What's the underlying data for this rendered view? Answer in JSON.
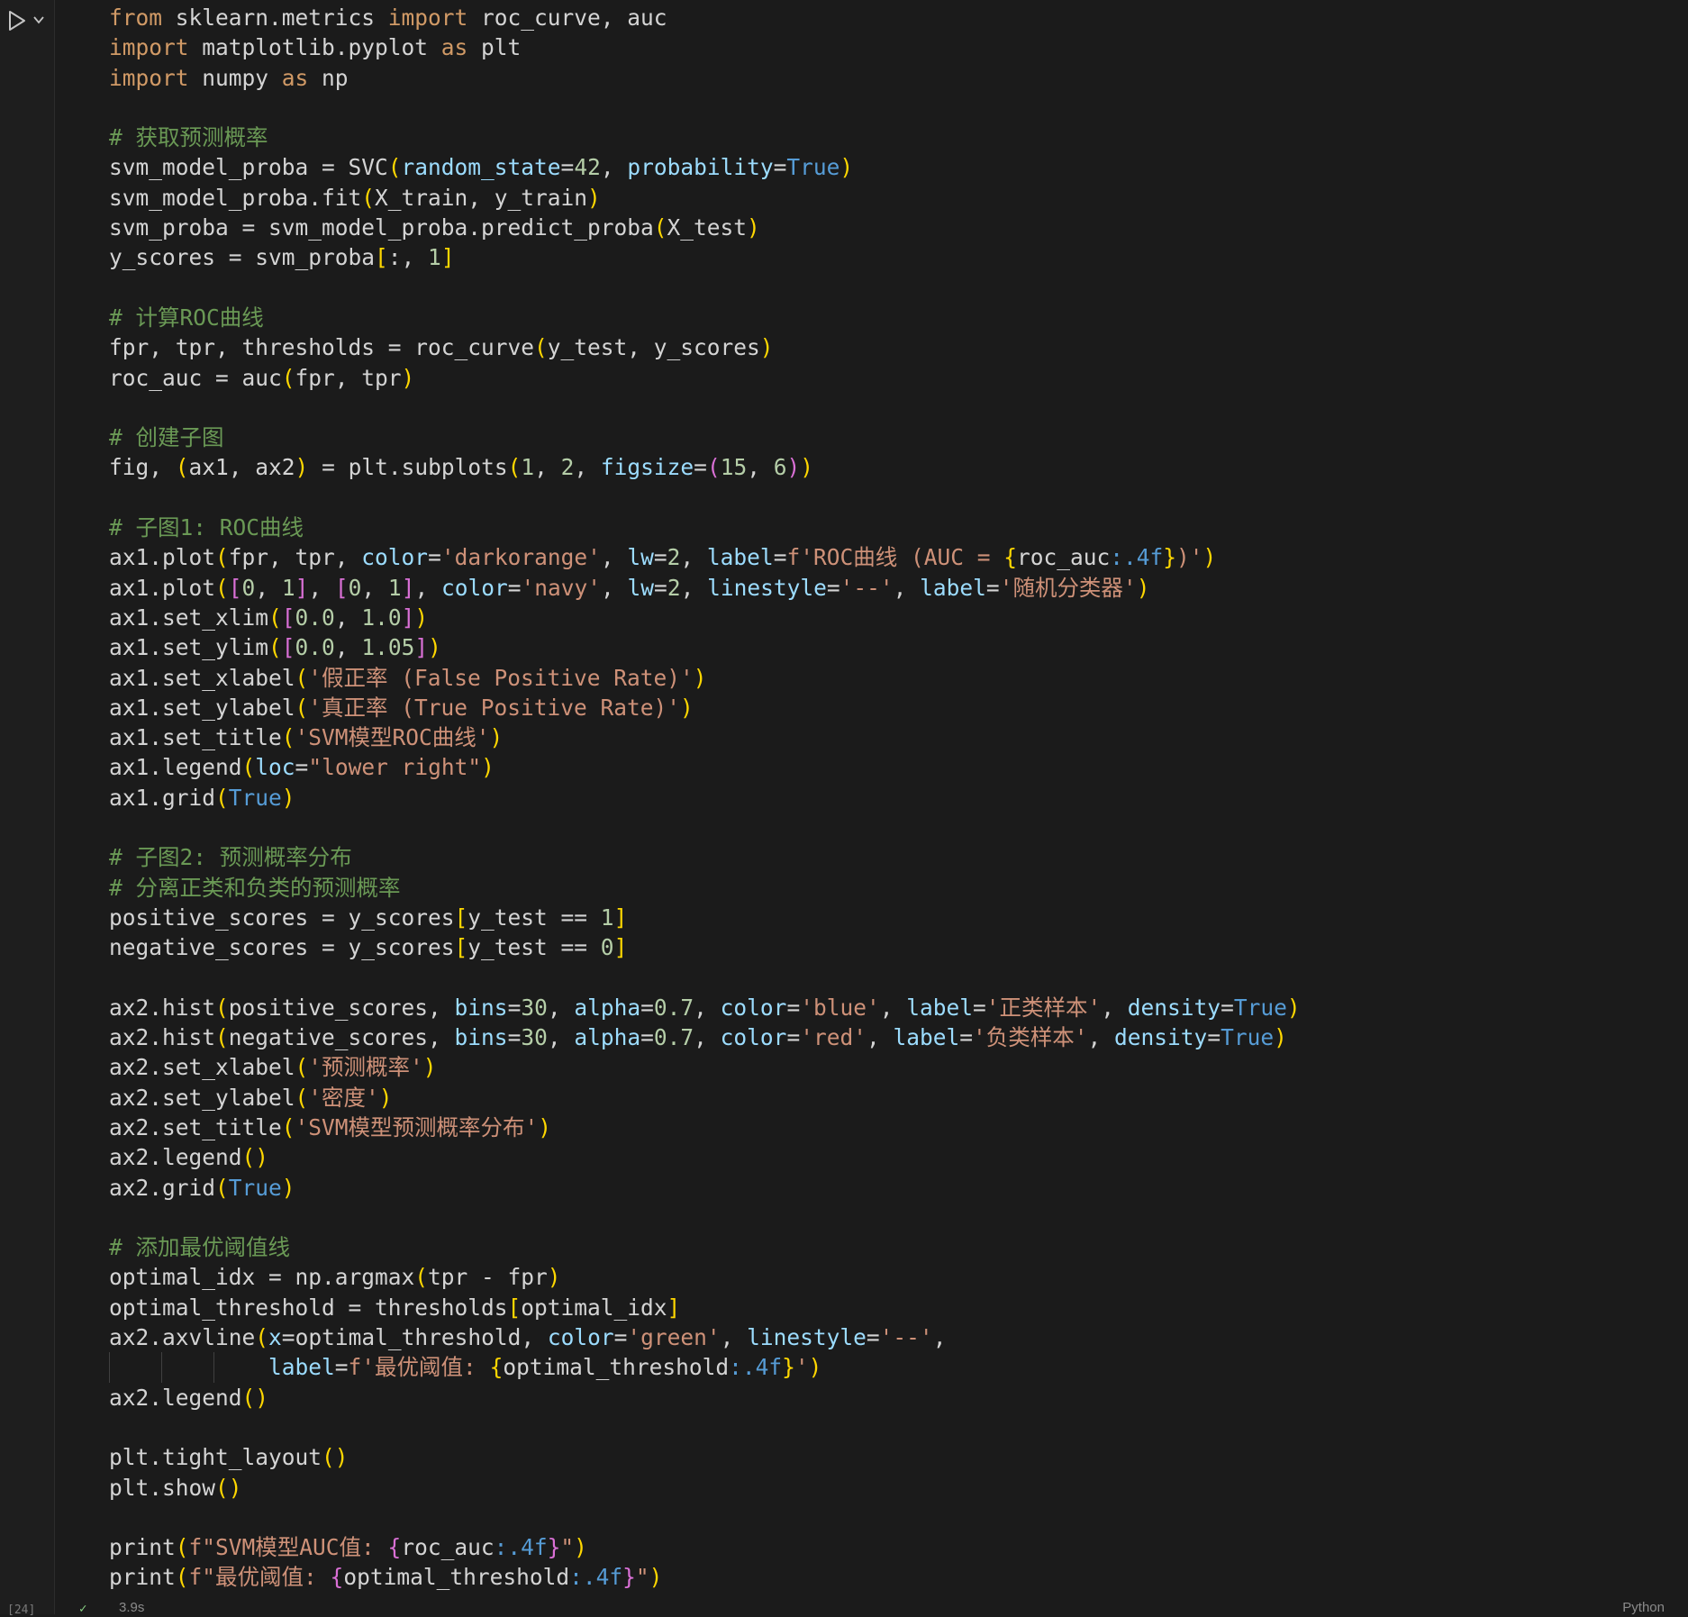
{
  "cell": {
    "execution_count": "[24]",
    "duration": "3.9s",
    "language": "Python",
    "status_icon": "check-icon"
  },
  "colors": {
    "default": "#d4d4d4",
    "keyword": "#ce9178",
    "import_keyword": "#d19a66",
    "string": "#ce9178",
    "number": "#b5cea8",
    "comment": "#6a9955",
    "param": "#9cdcfe",
    "constant": "#569cd6",
    "bracket_yellow": "#ffd700",
    "bracket_purple": "#da70d6",
    "bracket_blue": "#179fff"
  },
  "code_lines": [
    {
      "guides": 0,
      "tokens": [
        [
          "from ",
          "k"
        ],
        [
          "sklearn.metrics ",
          "d"
        ],
        [
          "import ",
          "k"
        ],
        [
          "roc_curve, auc",
          "d"
        ]
      ]
    },
    {
      "guides": 0,
      "tokens": [
        [
          "import ",
          "k"
        ],
        [
          "matplotlib.pyplot ",
          "d"
        ],
        [
          "as ",
          "k"
        ],
        [
          "plt",
          "d"
        ]
      ]
    },
    {
      "guides": 0,
      "tokens": [
        [
          "import ",
          "k"
        ],
        [
          "numpy ",
          "d"
        ],
        [
          "as ",
          "k"
        ],
        [
          "np",
          "d"
        ]
      ]
    },
    {
      "guides": 0,
      "tokens": []
    },
    {
      "guides": 0,
      "tokens": [
        [
          "# 获取预测概率",
          "c"
        ]
      ]
    },
    {
      "guides": 0,
      "tokens": [
        [
          "svm_model_proba = SVC",
          "d"
        ],
        [
          "(",
          "y"
        ],
        [
          "random_state",
          "p"
        ],
        [
          "=",
          "d"
        ],
        [
          "42",
          "n"
        ],
        [
          ", ",
          "d"
        ],
        [
          "probability",
          "p"
        ],
        [
          "=",
          "d"
        ],
        [
          "True",
          "b"
        ],
        [
          ")",
          "y"
        ]
      ]
    },
    {
      "guides": 0,
      "tokens": [
        [
          "svm_model_proba.fit",
          "d"
        ],
        [
          "(",
          "y"
        ],
        [
          "X_train, y_train",
          "d"
        ],
        [
          ")",
          "y"
        ]
      ]
    },
    {
      "guides": 0,
      "tokens": [
        [
          "svm_proba = svm_model_proba.predict_proba",
          "d"
        ],
        [
          "(",
          "y"
        ],
        [
          "X_test",
          "d"
        ],
        [
          ")",
          "y"
        ]
      ]
    },
    {
      "guides": 0,
      "tokens": [
        [
          "y_scores = svm_proba",
          "d"
        ],
        [
          "[",
          "y"
        ],
        [
          ":, ",
          "d"
        ],
        [
          "1",
          "n"
        ],
        [
          "]",
          "y"
        ]
      ]
    },
    {
      "guides": 0,
      "tokens": []
    },
    {
      "guides": 0,
      "tokens": [
        [
          "# 计算ROC曲线",
          "c"
        ]
      ]
    },
    {
      "guides": 0,
      "tokens": [
        [
          "fpr, tpr, thresholds = roc_curve",
          "d"
        ],
        [
          "(",
          "y"
        ],
        [
          "y_test, y_scores",
          "d"
        ],
        [
          ")",
          "y"
        ]
      ]
    },
    {
      "guides": 0,
      "tokens": [
        [
          "roc_auc = auc",
          "d"
        ],
        [
          "(",
          "y"
        ],
        [
          "fpr, tpr",
          "d"
        ],
        [
          ")",
          "y"
        ]
      ]
    },
    {
      "guides": 0,
      "tokens": []
    },
    {
      "guides": 0,
      "tokens": [
        [
          "# 创建子图",
          "c"
        ]
      ]
    },
    {
      "guides": 0,
      "tokens": [
        [
          "fig, ",
          "d"
        ],
        [
          "(",
          "y"
        ],
        [
          "ax1, ax2",
          "d"
        ],
        [
          ")",
          "y"
        ],
        [
          " = plt.subplots",
          "d"
        ],
        [
          "(",
          "y"
        ],
        [
          "1",
          "n"
        ],
        [
          ", ",
          "d"
        ],
        [
          "2",
          "n"
        ],
        [
          ", ",
          "d"
        ],
        [
          "figsize",
          "p"
        ],
        [
          "=",
          "d"
        ],
        [
          "(",
          "v"
        ],
        [
          "15",
          "n"
        ],
        [
          ", ",
          "d"
        ],
        [
          "6",
          "n"
        ],
        [
          ")",
          "v"
        ],
        [
          ")",
          "y"
        ]
      ]
    },
    {
      "guides": 0,
      "tokens": []
    },
    {
      "guides": 0,
      "tokens": [
        [
          "# 子图1: ROC曲线",
          "c"
        ]
      ]
    },
    {
      "guides": 0,
      "tokens": [
        [
          "ax1.plot",
          "d"
        ],
        [
          "(",
          "y"
        ],
        [
          "fpr, tpr, ",
          "d"
        ],
        [
          "color",
          "p"
        ],
        [
          "=",
          "d"
        ],
        [
          "'darkorange'",
          "s"
        ],
        [
          ", ",
          "d"
        ],
        [
          "lw",
          "p"
        ],
        [
          "=",
          "d"
        ],
        [
          "2",
          "n"
        ],
        [
          ", ",
          "d"
        ],
        [
          "label",
          "p"
        ],
        [
          "=",
          "d"
        ],
        [
          "f'ROC曲线 (AUC = ",
          "s"
        ],
        [
          "{",
          "y"
        ],
        [
          "roc_auc",
          "d"
        ],
        [
          ":.4f",
          "b"
        ],
        [
          "}",
          "y"
        ],
        [
          ")'",
          "s"
        ],
        [
          ")",
          "y"
        ]
      ]
    },
    {
      "guides": 0,
      "tokens": [
        [
          "ax1.plot",
          "d"
        ],
        [
          "(",
          "y"
        ],
        [
          "[",
          "v"
        ],
        [
          "0",
          "n"
        ],
        [
          ", ",
          "d"
        ],
        [
          "1",
          "n"
        ],
        [
          "]",
          "v"
        ],
        [
          ", ",
          "d"
        ],
        [
          "[",
          "v"
        ],
        [
          "0",
          "n"
        ],
        [
          ", ",
          "d"
        ],
        [
          "1",
          "n"
        ],
        [
          "]",
          "v"
        ],
        [
          ", ",
          "d"
        ],
        [
          "color",
          "p"
        ],
        [
          "=",
          "d"
        ],
        [
          "'navy'",
          "s"
        ],
        [
          ", ",
          "d"
        ],
        [
          "lw",
          "p"
        ],
        [
          "=",
          "d"
        ],
        [
          "2",
          "n"
        ],
        [
          ", ",
          "d"
        ],
        [
          "linestyle",
          "p"
        ],
        [
          "=",
          "d"
        ],
        [
          "'--'",
          "s"
        ],
        [
          ", ",
          "d"
        ],
        [
          "label",
          "p"
        ],
        [
          "=",
          "d"
        ],
        [
          "'随机分类器'",
          "s"
        ],
        [
          ")",
          "y"
        ]
      ]
    },
    {
      "guides": 0,
      "tokens": [
        [
          "ax1.set_xlim",
          "d"
        ],
        [
          "(",
          "y"
        ],
        [
          "[",
          "v"
        ],
        [
          "0.0",
          "n"
        ],
        [
          ", ",
          "d"
        ],
        [
          "1.0",
          "n"
        ],
        [
          "]",
          "v"
        ],
        [
          ")",
          "y"
        ]
      ]
    },
    {
      "guides": 0,
      "tokens": [
        [
          "ax1.set_ylim",
          "d"
        ],
        [
          "(",
          "y"
        ],
        [
          "[",
          "v"
        ],
        [
          "0.0",
          "n"
        ],
        [
          ", ",
          "d"
        ],
        [
          "1.05",
          "n"
        ],
        [
          "]",
          "v"
        ],
        [
          ")",
          "y"
        ]
      ]
    },
    {
      "guides": 0,
      "tokens": [
        [
          "ax1.set_xlabel",
          "d"
        ],
        [
          "(",
          "y"
        ],
        [
          "'假正率 (False Positive Rate)'",
          "s"
        ],
        [
          ")",
          "y"
        ]
      ]
    },
    {
      "guides": 0,
      "tokens": [
        [
          "ax1.set_ylabel",
          "d"
        ],
        [
          "(",
          "y"
        ],
        [
          "'真正率 (True Positive Rate)'",
          "s"
        ],
        [
          ")",
          "y"
        ]
      ]
    },
    {
      "guides": 0,
      "tokens": [
        [
          "ax1.set_title",
          "d"
        ],
        [
          "(",
          "y"
        ],
        [
          "'SVM模型ROC曲线'",
          "s"
        ],
        [
          ")",
          "y"
        ]
      ]
    },
    {
      "guides": 0,
      "tokens": [
        [
          "ax1.legend",
          "d"
        ],
        [
          "(",
          "y"
        ],
        [
          "loc",
          "p"
        ],
        [
          "=",
          "d"
        ],
        [
          "\"lower right\"",
          "s"
        ],
        [
          ")",
          "y"
        ]
      ]
    },
    {
      "guides": 0,
      "tokens": [
        [
          "ax1.grid",
          "d"
        ],
        [
          "(",
          "y"
        ],
        [
          "True",
          "b"
        ],
        [
          ")",
          "y"
        ]
      ]
    },
    {
      "guides": 0,
      "tokens": []
    },
    {
      "guides": 0,
      "tokens": [
        [
          "# 子图2: 预测概率分布",
          "c"
        ]
      ]
    },
    {
      "guides": 0,
      "tokens": [
        [
          "# 分离正类和负类的预测概率",
          "c"
        ]
      ]
    },
    {
      "guides": 0,
      "tokens": [
        [
          "positive_scores = y_scores",
          "d"
        ],
        [
          "[",
          "y"
        ],
        [
          "y_test == ",
          "d"
        ],
        [
          "1",
          "n"
        ],
        [
          "]",
          "y"
        ]
      ]
    },
    {
      "guides": 0,
      "tokens": [
        [
          "negative_scores = y_scores",
          "d"
        ],
        [
          "[",
          "y"
        ],
        [
          "y_test == ",
          "d"
        ],
        [
          "0",
          "n"
        ],
        [
          "]",
          "y"
        ]
      ]
    },
    {
      "guides": 0,
      "tokens": []
    },
    {
      "guides": 0,
      "tokens": [
        [
          "ax2.hist",
          "d"
        ],
        [
          "(",
          "y"
        ],
        [
          "positive_scores, ",
          "d"
        ],
        [
          "bins",
          "p"
        ],
        [
          "=",
          "d"
        ],
        [
          "30",
          "n"
        ],
        [
          ", ",
          "d"
        ],
        [
          "alpha",
          "p"
        ],
        [
          "=",
          "d"
        ],
        [
          "0.7",
          "n"
        ],
        [
          ", ",
          "d"
        ],
        [
          "color",
          "p"
        ],
        [
          "=",
          "d"
        ],
        [
          "'blue'",
          "s"
        ],
        [
          ", ",
          "d"
        ],
        [
          "label",
          "p"
        ],
        [
          "=",
          "d"
        ],
        [
          "'正类样本'",
          "s"
        ],
        [
          ", ",
          "d"
        ],
        [
          "density",
          "p"
        ],
        [
          "=",
          "d"
        ],
        [
          "True",
          "b"
        ],
        [
          ")",
          "y"
        ]
      ]
    },
    {
      "guides": 0,
      "tokens": [
        [
          "ax2.hist",
          "d"
        ],
        [
          "(",
          "y"
        ],
        [
          "negative_scores, ",
          "d"
        ],
        [
          "bins",
          "p"
        ],
        [
          "=",
          "d"
        ],
        [
          "30",
          "n"
        ],
        [
          ", ",
          "d"
        ],
        [
          "alpha",
          "p"
        ],
        [
          "=",
          "d"
        ],
        [
          "0.7",
          "n"
        ],
        [
          ", ",
          "d"
        ],
        [
          "color",
          "p"
        ],
        [
          "=",
          "d"
        ],
        [
          "'red'",
          "s"
        ],
        [
          ", ",
          "d"
        ],
        [
          "label",
          "p"
        ],
        [
          "=",
          "d"
        ],
        [
          "'负类样本'",
          "s"
        ],
        [
          ", ",
          "d"
        ],
        [
          "density",
          "p"
        ],
        [
          "=",
          "d"
        ],
        [
          "True",
          "b"
        ],
        [
          ")",
          "y"
        ]
      ]
    },
    {
      "guides": 0,
      "tokens": [
        [
          "ax2.set_xlabel",
          "d"
        ],
        [
          "(",
          "y"
        ],
        [
          "'预测概率'",
          "s"
        ],
        [
          ")",
          "y"
        ]
      ]
    },
    {
      "guides": 0,
      "tokens": [
        [
          "ax2.set_ylabel",
          "d"
        ],
        [
          "(",
          "y"
        ],
        [
          "'密度'",
          "s"
        ],
        [
          ")",
          "y"
        ]
      ]
    },
    {
      "guides": 0,
      "tokens": [
        [
          "ax2.set_title",
          "d"
        ],
        [
          "(",
          "y"
        ],
        [
          "'SVM模型预测概率分布'",
          "s"
        ],
        [
          ")",
          "y"
        ]
      ]
    },
    {
      "guides": 0,
      "tokens": [
        [
          "ax2.legend",
          "d"
        ],
        [
          "()",
          "y"
        ]
      ]
    },
    {
      "guides": 0,
      "tokens": [
        [
          "ax2.grid",
          "d"
        ],
        [
          "(",
          "y"
        ],
        [
          "True",
          "b"
        ],
        [
          ")",
          "y"
        ]
      ]
    },
    {
      "guides": 0,
      "tokens": []
    },
    {
      "guides": 0,
      "tokens": [
        [
          "# 添加最优阈值线",
          "c"
        ]
      ]
    },
    {
      "guides": 0,
      "tokens": [
        [
          "optimal_idx = np.argmax",
          "d"
        ],
        [
          "(",
          "y"
        ],
        [
          "tpr - fpr",
          "d"
        ],
        [
          ")",
          "y"
        ]
      ]
    },
    {
      "guides": 0,
      "tokens": [
        [
          "optimal_threshold = thresholds",
          "d"
        ],
        [
          "[",
          "y"
        ],
        [
          "optimal_idx",
          "d"
        ],
        [
          "]",
          "y"
        ]
      ]
    },
    {
      "guides": 0,
      "tokens": [
        [
          "ax2.axvline",
          "d"
        ],
        [
          "(",
          "y"
        ],
        [
          "x",
          "p"
        ],
        [
          "=",
          "d"
        ],
        [
          "optimal_threshold, ",
          "d"
        ],
        [
          "color",
          "p"
        ],
        [
          "=",
          "d"
        ],
        [
          "'green'",
          "s"
        ],
        [
          ", ",
          "d"
        ],
        [
          "linestyle",
          "p"
        ],
        [
          "=",
          "d"
        ],
        [
          "'--'",
          "s"
        ],
        [
          ",",
          "d"
        ]
      ]
    },
    {
      "guides": 3,
      "tokens": [
        [
          "            ",
          "d"
        ],
        [
          "label",
          "p"
        ],
        [
          "=",
          "d"
        ],
        [
          "f'最优阈值: ",
          "s"
        ],
        [
          "{",
          "y"
        ],
        [
          "optimal_threshold",
          "d"
        ],
        [
          ":.4f",
          "b"
        ],
        [
          "}",
          "y"
        ],
        [
          "'",
          "s"
        ],
        [
          ")",
          "y"
        ]
      ]
    },
    {
      "guides": 0,
      "tokens": [
        [
          "ax2.legend",
          "d"
        ],
        [
          "()",
          "y"
        ]
      ]
    },
    {
      "guides": 0,
      "tokens": []
    },
    {
      "guides": 0,
      "tokens": [
        [
          "plt.tight_layout",
          "d"
        ],
        [
          "()",
          "y"
        ]
      ]
    },
    {
      "guides": 0,
      "tokens": [
        [
          "plt.show",
          "d"
        ],
        [
          "()",
          "y"
        ]
      ]
    },
    {
      "guides": 0,
      "tokens": []
    },
    {
      "guides": 0,
      "tokens": [
        [
          "print",
          "d"
        ],
        [
          "(",
          "y"
        ],
        [
          "f\"SVM模型AUC值: ",
          "s"
        ],
        [
          "{",
          "v"
        ],
        [
          "roc_auc",
          "d"
        ],
        [
          ":.4f",
          "b"
        ],
        [
          "}",
          "v"
        ],
        [
          "\"",
          "s"
        ],
        [
          ")",
          "y"
        ]
      ]
    },
    {
      "guides": 0,
      "tokens": [
        [
          "print",
          "d"
        ],
        [
          "(",
          "y"
        ],
        [
          "f\"最优阈值: ",
          "s"
        ],
        [
          "{",
          "v"
        ],
        [
          "optimal_threshold",
          "d"
        ],
        [
          ":.4f",
          "b"
        ],
        [
          "}",
          "v"
        ],
        [
          "\"",
          "s"
        ],
        [
          ")",
          "y"
        ]
      ]
    }
  ]
}
